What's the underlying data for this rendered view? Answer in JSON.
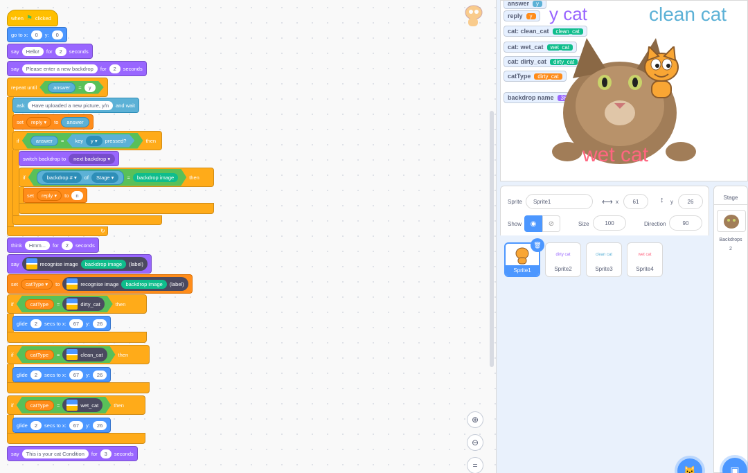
{
  "code": {
    "hat": {
      "when": "when",
      "clicked": "clicked"
    },
    "goto": {
      "label": "go to x:",
      "x": "0",
      "ylabel": "y:",
      "y": "0"
    },
    "say1": {
      "say": "say",
      "text": "Hello!",
      "for": "for",
      "secs": "2",
      "seconds": "seconds"
    },
    "say2": {
      "say": "say",
      "text": "Please enter a new backdrop",
      "for": "for",
      "secs": "2",
      "seconds": "seconds"
    },
    "repeat": {
      "label": "repeat until",
      "var": "answer",
      "eq": "=",
      "val": "y"
    },
    "ask": {
      "label": "ask",
      "text": "Have uploaded a new picture, y/n",
      "wait": "and wait"
    },
    "setreply": {
      "set": "set",
      "var": "reply",
      "to": "to",
      "val": "answer"
    },
    "if1": {
      "if": "if",
      "answer": "answer",
      "eq": "=",
      "key": "key",
      "keyval": "y",
      "pressed": "pressed?",
      "then": "then"
    },
    "switch": {
      "label": "switch backdrop to",
      "val": "next backdrop"
    },
    "if2": {
      "if": "if",
      "prop": "backdrop #",
      "of": "of",
      "obj": "Stage",
      "eq": "=",
      "img": "backdrop image",
      "then": "then"
    },
    "setreply2": {
      "set": "set",
      "var": "reply",
      "to": "to",
      "val": "n"
    },
    "think": {
      "label": "think",
      "text": "Hmm...",
      "for": "for",
      "secs": "2",
      "seconds": "seconds"
    },
    "say3": {
      "say": "say",
      "recognise": "recognise image",
      "img": "backdrop image",
      "label": "(label)"
    },
    "setcat": {
      "set": "set",
      "var": "catType",
      "to": "to",
      "recognise": "recognise image",
      "img": "backdrop image",
      "label": "(label)"
    },
    "ifdirty": {
      "if": "if",
      "var": "catType",
      "eq": "=",
      "cls": "dirty_cat",
      "then": "then"
    },
    "glide1": {
      "glide": "glide",
      "secs": "2",
      "to": "secs to x:",
      "x": "67",
      "ylabel": "y:",
      "y": "26"
    },
    "ifclean": {
      "if": "if",
      "var": "catType",
      "eq": "=",
      "cls": "clean_cat",
      "then": "then"
    },
    "glide2": {
      "glide": "glide",
      "secs": "2",
      "to": "secs to x:",
      "x": "67",
      "ylabel": "y:",
      "y": "26"
    },
    "ifwet": {
      "if": "if",
      "var": "catType",
      "eq": "=",
      "cls": "wet_cat",
      "then": "then"
    },
    "glide3": {
      "glide": "glide",
      "secs": "2",
      "to": "secs to x:",
      "x": "67",
      "ylabel": "y:",
      "y": "26"
    },
    "sayfinal": {
      "say": "say",
      "text": "This is your cat Condition",
      "for": "for",
      "secs": "3",
      "seconds": "seconds"
    }
  },
  "stage": {
    "monitors": [
      {
        "name": "answer",
        "value": "y",
        "color": "#5cb1d6"
      },
      {
        "name": "reply",
        "value": "y",
        "color": "#ff8c1a"
      },
      {
        "name": "cat: clean_cat",
        "value": "clean_cat",
        "color": "#0fbd8c"
      },
      {
        "name": "cat: wet_cat",
        "value": "wet_cat",
        "color": "#0fbd8c"
      },
      {
        "name": "cat: dirty_cat",
        "value": "dirty_cat",
        "color": "#0fbd8c"
      },
      {
        "name": "catType",
        "value": "dirty_cat",
        "color": "#ff8c1a"
      },
      {
        "name": "backdrop name",
        "value": "3683",
        "color": "#9966ff"
      }
    ],
    "text_dirty": "y cat",
    "text_clean": "clean cat",
    "text_wet": "wet cat"
  },
  "sprite_info": {
    "sprite_label": "Sprite",
    "sprite_name": "Sprite1",
    "x_label": "x",
    "x": "61",
    "y_label": "y",
    "y": "26",
    "show_label": "Show",
    "size_label": "Size",
    "size": "100",
    "direction_label": "Direction",
    "direction": "90"
  },
  "sprites": [
    {
      "name": "Sprite1",
      "thumb": ""
    },
    {
      "name": "Sprite2",
      "thumb": "dirty cat"
    },
    {
      "name": "Sprite3",
      "thumb": "clean cat"
    },
    {
      "name": "Sprite4",
      "thumb": "wet cat"
    }
  ],
  "stage_panel": {
    "title": "Stage",
    "backdrops_label": "Backdrops",
    "backdrops_count": "2"
  },
  "colors": {
    "accent": "#4c97ff",
    "events": "#ffbf00",
    "motion": "#4c97ff",
    "looks": "#9966ff",
    "control": "#ffab19",
    "sensing": "#5cb1d6",
    "variables": "#ff8c1a",
    "operators": "#59c059",
    "ml": "#0fbd8c"
  }
}
